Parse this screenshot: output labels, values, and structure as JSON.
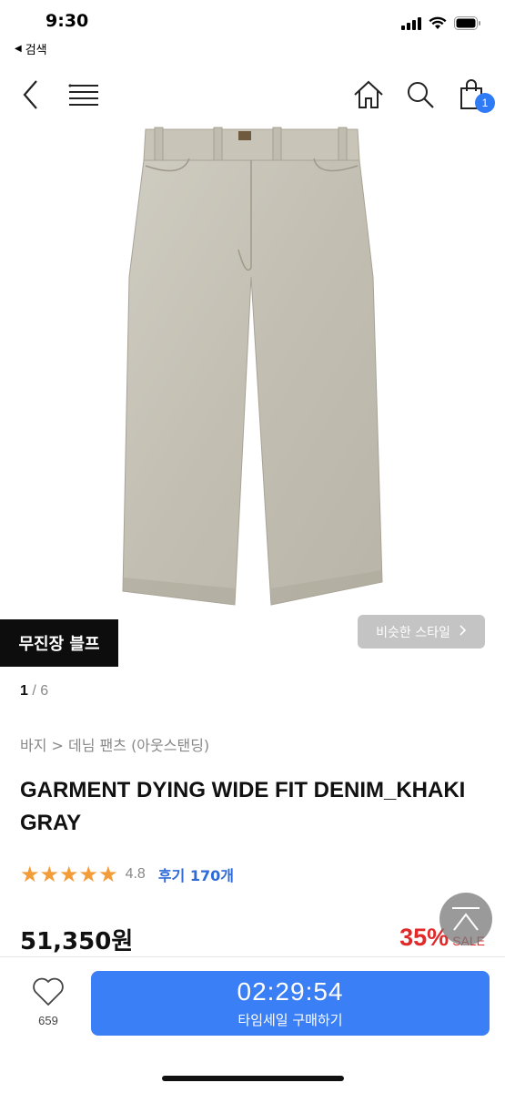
{
  "status_bar": {
    "time": "9:30",
    "back_label": "검색"
  },
  "nav": {
    "back_icon": "chevron-left-icon",
    "menu_icon": "menu-icon",
    "home_icon": "home-icon",
    "search_icon": "search-icon",
    "cart_icon": "shopping-bag-icon",
    "cart_count": "1"
  },
  "product": {
    "image_alt": "pants-image",
    "brand": "무진장 블프",
    "similar_style_label": "비슷한 스타일",
    "image_index": "1",
    "image_separator": "/",
    "image_total": "6",
    "category": "바지 > 데님 팬츠 (아웃스탠딩)",
    "title": "GARMENT DYING WIDE FIT DENIM_KHAKI GRAY",
    "rating": "4.8",
    "stars": 5,
    "review_label": "후기 170개",
    "price": "51,350원",
    "discount": "35%",
    "sale_label": "SALE"
  },
  "bottom_bar": {
    "like_count": "659",
    "timer": "02:29:54",
    "buy_label": "타임세일 구매하기"
  },
  "colors": {
    "accent": "#3a7ff5",
    "star": "#f39c3a",
    "discount": "#e02a2a",
    "review_link": "#2f6bd8"
  }
}
